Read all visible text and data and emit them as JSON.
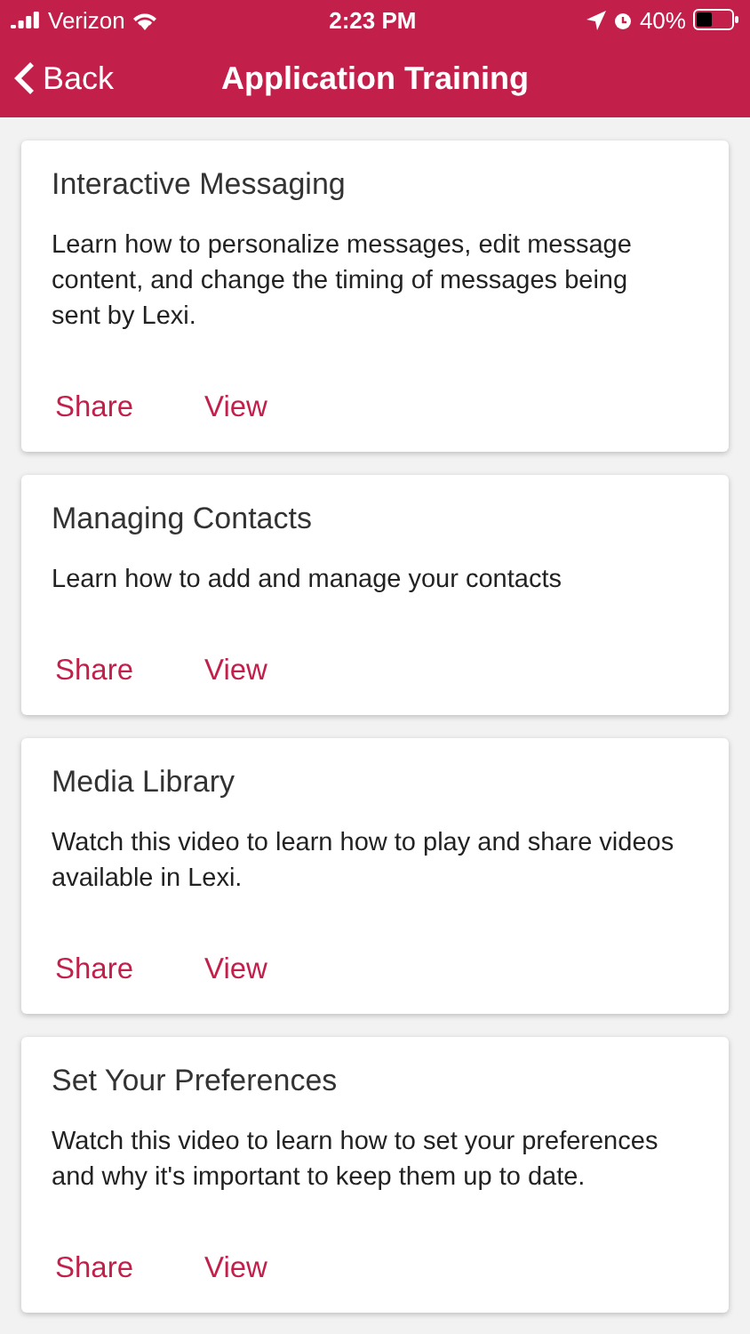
{
  "status_bar": {
    "carrier": "Verizon",
    "time": "2:23 PM",
    "battery": "40%"
  },
  "nav": {
    "back": "Back",
    "title": "Application Training"
  },
  "cards": [
    {
      "title": "Interactive Messaging",
      "description": "Learn how to personalize messages, edit message content, and change the timing of messages being sent by Lexi.",
      "actions": [
        "Share",
        "View"
      ]
    },
    {
      "title": "Managing Contacts",
      "description": "Learn how to add and manage your contacts",
      "actions": [
        "Share",
        "View"
      ]
    },
    {
      "title": "Media Library",
      "description": "Watch this video to learn how to play and share videos available in Lexi.",
      "actions": [
        "Share",
        "View"
      ]
    },
    {
      "title": "Set Your Preferences",
      "description": "Watch this video to learn how to set your preferences and why it's important to keep them up to date.",
      "actions": [
        "Share",
        "View"
      ]
    }
  ]
}
